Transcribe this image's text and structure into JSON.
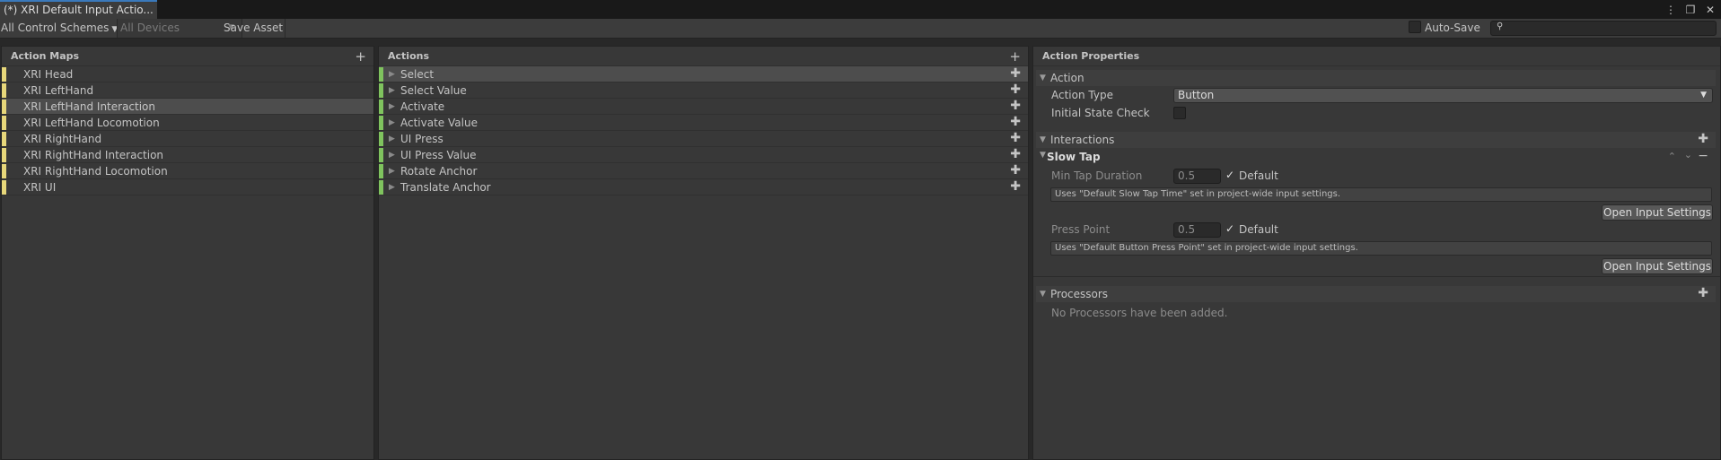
{
  "window": {
    "tab_title": "(*) XRI Default Input Actio...",
    "icons": [
      "more-vert-icon",
      "maximize-icon",
      "close-icon"
    ]
  },
  "toolbar": {
    "control_schemes": "All Control Schemes",
    "devices": "All Devices",
    "save_asset": "Save Asset",
    "auto_save": "Auto-Save",
    "search_placeholder": ""
  },
  "action_maps": {
    "header": "Action Maps",
    "items": [
      {
        "label": "XRI Head"
      },
      {
        "label": "XRI LeftHand"
      },
      {
        "label": "XRI LeftHand Interaction",
        "selected": true
      },
      {
        "label": "XRI LeftHand Locomotion"
      },
      {
        "label": "XRI RightHand"
      },
      {
        "label": "XRI RightHand Interaction"
      },
      {
        "label": "XRI RightHand Locomotion"
      },
      {
        "label": "XRI UI"
      }
    ]
  },
  "actions": {
    "header": "Actions",
    "items": [
      {
        "label": "Select",
        "selected": true
      },
      {
        "label": "Select Value"
      },
      {
        "label": "Activate"
      },
      {
        "label": "Activate Value"
      },
      {
        "label": "UI Press"
      },
      {
        "label": "UI Press Value"
      },
      {
        "label": "Rotate Anchor"
      },
      {
        "label": "Translate Anchor"
      }
    ]
  },
  "properties": {
    "header": "Action Properties",
    "action_section": "Action",
    "action_type_label": "Action Type",
    "action_type_value": "Button",
    "initial_state_label": "Initial State Check",
    "interactions_section": "Interactions",
    "slow_tap": {
      "title": "Slow Tap",
      "min_tap_label": "Min Tap Duration",
      "min_tap_value": "0.5",
      "default_label": "Default",
      "min_tap_help": "Uses \"Default Slow Tap Time\" set in project-wide input settings.",
      "open_settings": "Open Input Settings",
      "press_point_label": "Press Point",
      "press_point_value": "0.5",
      "press_point_help": "Uses \"Default Button Press Point\" set in project-wide input settings."
    },
    "processors_section": "Processors",
    "processors_empty": "No Processors have been added."
  },
  "colors": {
    "map_accent": "#e7d77a",
    "action_accent": "#7fc35e",
    "tab_accent": "#3a79bb"
  }
}
